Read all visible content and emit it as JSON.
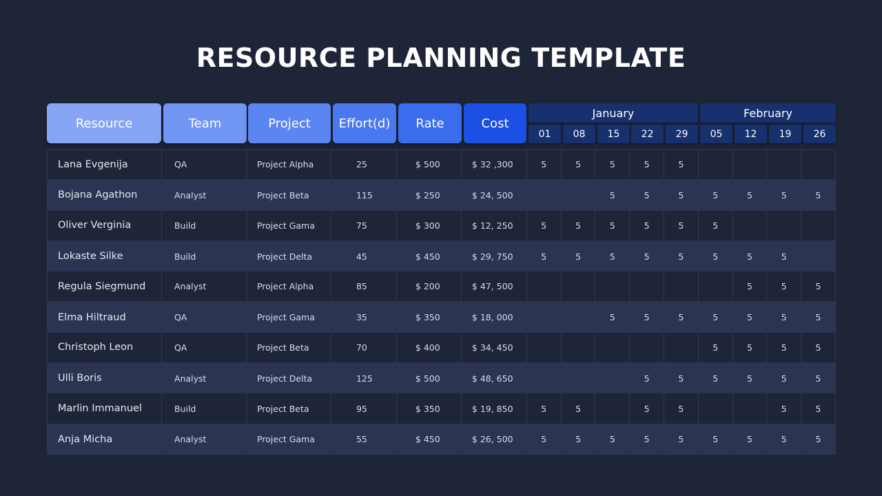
{
  "title": "RESOURCE PLANNING TEMPLATE",
  "headers": {
    "resource": "Resource",
    "team": "Team",
    "project": "Project",
    "effort": "Effort(d)",
    "rate": "Rate",
    "cost": "Cost"
  },
  "months": [
    {
      "name": "January",
      "weeks": [
        "01",
        "08",
        "15",
        "22",
        "29"
      ]
    },
    {
      "name": "February",
      "weeks": [
        "05",
        "12",
        "19",
        "26"
      ]
    }
  ],
  "rows": [
    {
      "resource": "Lana Evgenija",
      "team": "QA",
      "project": "Project Alpha",
      "effort": "25",
      "rate": "$ 500",
      "cost": "$ 32 ,300",
      "weeks": [
        "5",
        "5",
        "5",
        "5",
        "5",
        "",
        "",
        "",
        ""
      ]
    },
    {
      "resource": "Bojana Agathon",
      "team": "Analyst",
      "project": "Project Beta",
      "effort": "115",
      "rate": "$ 250",
      "cost": "$ 24, 500",
      "weeks": [
        "",
        "",
        "5",
        "5",
        "5",
        "5",
        "5",
        "5",
        "5"
      ]
    },
    {
      "resource": "Oliver Verginia",
      "team": "Build",
      "project": "Project Gama",
      "effort": "75",
      "rate": "$ 300",
      "cost": "$ 12, 250",
      "weeks": [
        "5",
        "5",
        "5",
        "5",
        "5",
        "5",
        "",
        "",
        ""
      ]
    },
    {
      "resource": "Lokaste Silke",
      "team": "Build",
      "project": "Project Delta",
      "effort": "45",
      "rate": "$ 450",
      "cost": "$ 29, 750",
      "weeks": [
        "5",
        "5",
        "5",
        "5",
        "5",
        "5",
        "5",
        "5",
        ""
      ]
    },
    {
      "resource": "Regula Siegmund",
      "team": "Analyst",
      "project": "Project Alpha",
      "effort": "85",
      "rate": "$ 200",
      "cost": "$ 47, 500",
      "weeks": [
        "",
        "",
        "",
        "",
        "",
        "",
        "5",
        "5",
        "5"
      ]
    },
    {
      "resource": "Elma Hiltraud",
      "team": "QA",
      "project": "Project Gama",
      "effort": "35",
      "rate": "$ 350",
      "cost": "$ 18, 000",
      "weeks": [
        "",
        "",
        "5",
        "5",
        "5",
        "5",
        "5",
        "5",
        "5"
      ]
    },
    {
      "resource": "Christoph Leon",
      "team": "QA",
      "project": "Project Beta",
      "effort": "70",
      "rate": "$ 400",
      "cost": "$ 34, 450",
      "weeks": [
        "",
        "",
        "",
        "",
        "",
        "5",
        "5",
        "5",
        "5"
      ]
    },
    {
      "resource": "Ulli Boris",
      "team": "Analyst",
      "project": "Project Delta",
      "effort": "125",
      "rate": "$ 500",
      "cost": "$ 48, 650",
      "weeks": [
        "",
        "",
        "",
        "5",
        "5",
        "5",
        "5",
        "5",
        "5"
      ]
    },
    {
      "resource": "Marlin Immanuel",
      "team": "Build",
      "project": "Project Beta",
      "effort": "95",
      "rate": "$ 350",
      "cost": "$ 19, 850",
      "weeks": [
        "5",
        "5",
        "",
        "5",
        "5",
        "",
        "",
        "5",
        "5"
      ]
    },
    {
      "resource": "Anja Micha",
      "team": "Analyst",
      "project": "Project Gama",
      "effort": "55",
      "rate": "$ 450",
      "cost": "$ 26, 500",
      "weeks": [
        "5",
        "5",
        "5",
        "5",
        "5",
        "5",
        "5",
        "5",
        "5"
      ]
    }
  ]
}
